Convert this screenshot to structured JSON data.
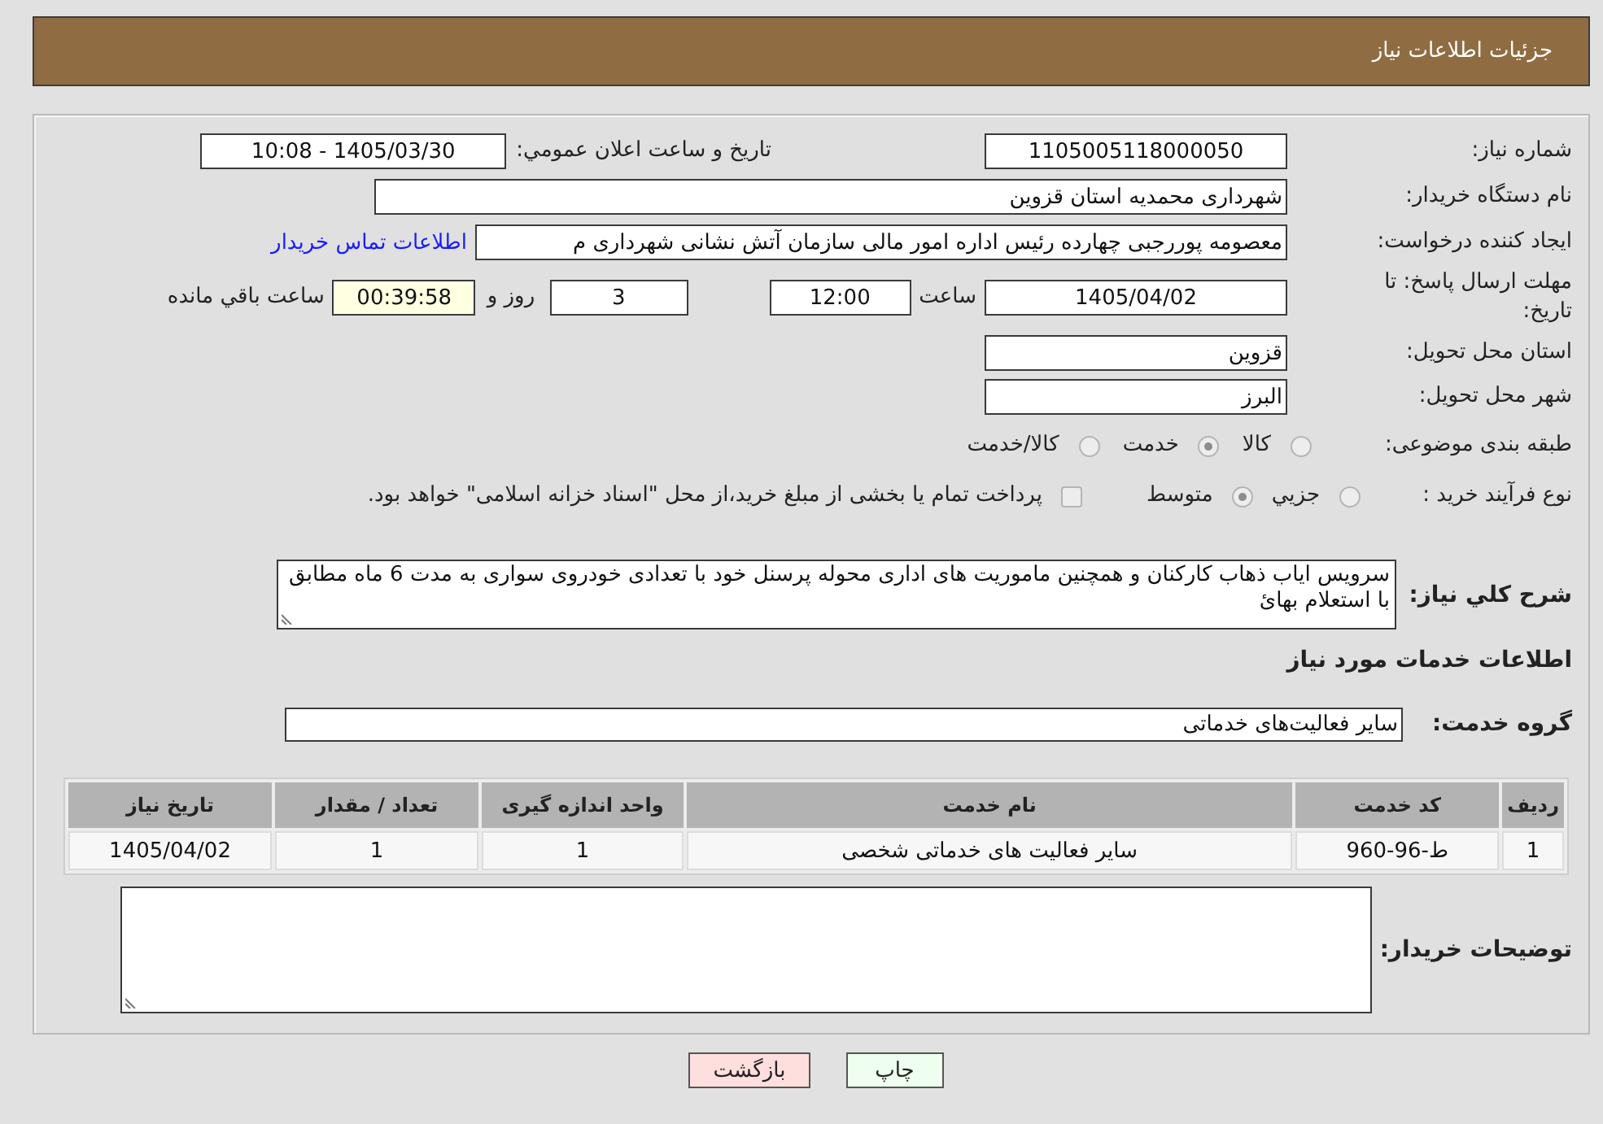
{
  "header": {
    "title": "جزئیات اطلاعات نیاز"
  },
  "need_number": {
    "label": "شماره نیاز:",
    "value": "1105005118000050"
  },
  "announcement": {
    "label": "تاریخ و ساعت اعلان عمومي:",
    "value": "1405/03/30 - 10:08"
  },
  "buyer_org": {
    "label": "نام دستگاه خریدار:",
    "value": "شهرداری محمدیه استان قزوین"
  },
  "requester": {
    "label": "ایجاد کننده درخواست:",
    "value": "معصومه پوررجبی چهارده رئیس اداره امور مالی سازمان آتش نشانی شهرداری م",
    "link": "اطلاعات تماس خریدار"
  },
  "deadline": {
    "label": "مهلت ارسال پاسخ: تا تاریخ:",
    "date": "1405/04/02",
    "time_label": "ساعت",
    "time": "12:00",
    "days": "3",
    "days_label": "روز و",
    "remaining": "00:39:58",
    "remaining_label": "ساعت باقي مانده"
  },
  "province": {
    "label": "استان محل تحویل:",
    "value": "قزوین"
  },
  "city": {
    "label": "شهر محل تحویل:",
    "value": "البرز"
  },
  "category": {
    "label": "طبقه بندی موضوعی:",
    "options": [
      {
        "label": "کالا",
        "selected": false
      },
      {
        "label": "خدمت",
        "selected": true
      },
      {
        "label": "کالا/خدمت",
        "selected": false
      }
    ]
  },
  "purchase_type": {
    "label": "نوع فرآیند خرید :",
    "options": [
      {
        "label": "جزيي",
        "selected": false
      },
      {
        "label": "متوسط",
        "selected": true
      }
    ],
    "treasury": {
      "label": "پرداخت تمام یا بخشی از مبلغ خرید،از محل \"اسناد خزانه اسلامی\" خواهد بود.",
      "checked": false
    }
  },
  "description": {
    "label": "شرح کلي نیاز:",
    "value": "سرویس ایاب ذهاب کارکنان و همچنین ماموریت های اداری محوله پرسنل خود با تعدادی خودروی سواری به مدت 6 ماه مطابق با استعلام بهائ"
  },
  "services_title": "اطلاعات خدمات مورد نیاز",
  "service_group": {
    "label": "گروه خدمت:",
    "value": "سایر فعالیت‌های خدماتی"
  },
  "table": {
    "columns": [
      "ردیف",
      "کد خدمت",
      "نام خدمت",
      "واحد اندازه گیری",
      "تعداد / مقدار",
      "تاریخ نیاز"
    ],
    "rows": [
      [
        "1",
        "ط-96-960",
        "سایر فعالیت های خدماتی شخصی",
        "1",
        "1",
        "1405/04/02"
      ]
    ]
  },
  "buyer_notes": {
    "label": "توضیحات خریدار:"
  },
  "buttons": [
    {
      "label": "چاپ",
      "kind": "print"
    },
    {
      "label": "بازگشت",
      "kind": "back"
    }
  ]
}
